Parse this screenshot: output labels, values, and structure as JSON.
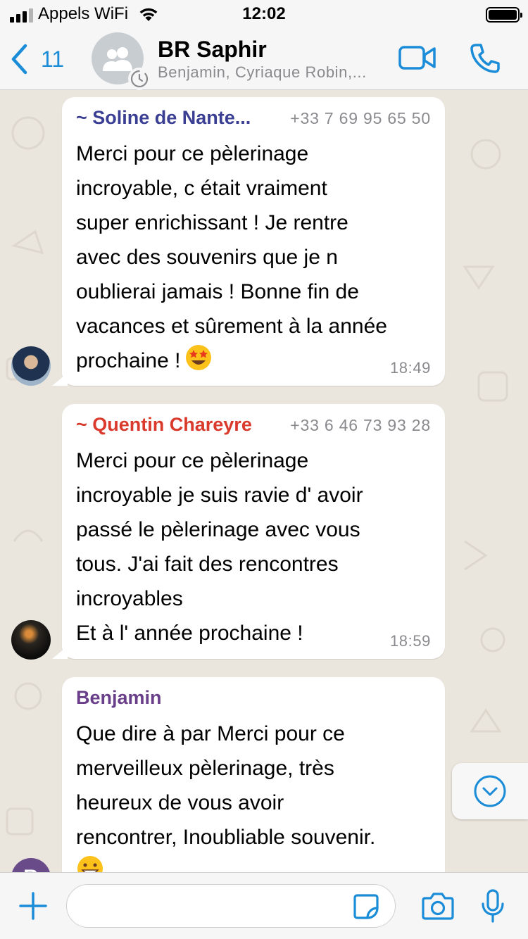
{
  "status_bar": {
    "carrier": "Appels WiFi",
    "time": "12:02"
  },
  "header": {
    "back_count": "11",
    "title": "BR Saphir",
    "subtitle": "Benjamin, Cyriaque Robin,..."
  },
  "messages": [
    {
      "sender": "~ Soline de Nante...",
      "sender_color": "#3b3f94",
      "phone": "+33 7 69 95 65 50",
      "text": "Merci pour ce pèlerinage\nincroyable, c était vraiment\nsuper enrichissant ! Je rentre\navec des souvenirs que je n\noublierai jamais ! Bonne fin de\nvacances et sûrement à la année\nprochaine !",
      "emoji": "star-struck-emoji",
      "time": "18:49"
    },
    {
      "sender": "~ Quentin Chareyre",
      "sender_color": "#d93a2b",
      "phone": "+33 6 46 73 93 28",
      "text": "Merci pour ce pèlerinage\nincroyable je suis ravie d' avoir\npassé le pèlerinage avec vous\ntous. J'ai fait des rencontres\nincroyables\nEt à l' année prochaine !",
      "time": "18:59"
    },
    {
      "sender": "Benjamin",
      "sender_color": "#6a3f8a",
      "avatar_letter": "B",
      "text": "Que dire à par Merci pour ce\nmerveilleux pèlerinage, très\nheureux de vous avoir\nrencontrer, Inoubliable souvenir.",
      "emoji": "grinning-emoji"
    }
  ],
  "composer": {
    "input_value": "",
    "input_placeholder": ""
  },
  "colors": {
    "accent": "#1a8cd8",
    "chat_background": "#ebe6dd",
    "bubble": "#ffffff"
  }
}
